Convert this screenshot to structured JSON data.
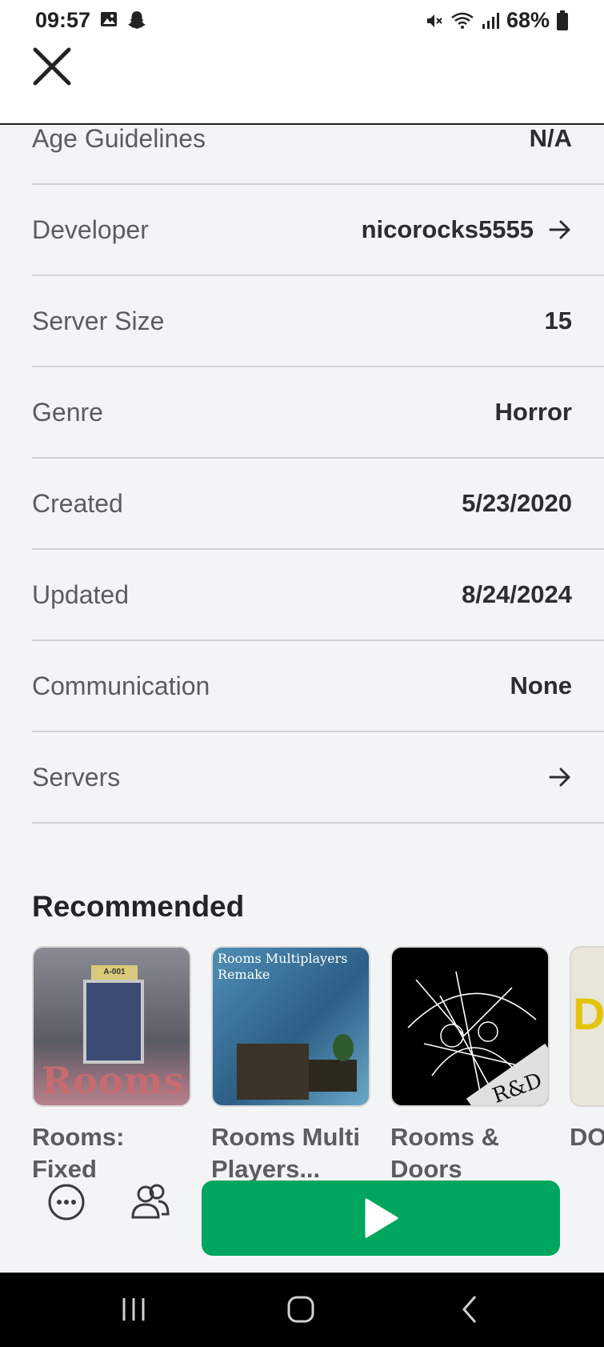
{
  "status_bar": {
    "time": "09:57",
    "battery": "68%",
    "icons_left": [
      "image-icon",
      "snapchat-icon"
    ],
    "icons_right": [
      "mute-icon",
      "wifi-icon",
      "signal-icon",
      "battery-icon"
    ]
  },
  "info_rows": [
    {
      "label": "Age Guidelines",
      "value": "N/A"
    },
    {
      "label": "Developer",
      "value": "nicorocks5555"
    },
    {
      "label": "Server Size",
      "value": "15"
    },
    {
      "label": "Genre",
      "value": "Horror"
    },
    {
      "label": "Created",
      "value": "5/23/2020"
    },
    {
      "label": "Updated",
      "value": "8/24/2024"
    },
    {
      "label": "Communication",
      "value": "None"
    },
    {
      "label": "Servers",
      "value": ""
    }
  ],
  "recommended": {
    "title": "Recommended",
    "items": [
      {
        "name": "Rooms: Fixed Expanded",
        "thumb_sign": "A-001",
        "thumb_logo": "Rooms"
      },
      {
        "name": "Rooms Multi Players...",
        "thumb_caption": "Rooms Multiplayers Remake"
      },
      {
        "name": "Rooms & Doors",
        "thumb_mark": "R&D"
      },
      {
        "name": "DO Ro",
        "thumb_text": "D"
      }
    ]
  },
  "colors": {
    "accent_play": "#00a65e",
    "background": "#f2f4f5"
  }
}
